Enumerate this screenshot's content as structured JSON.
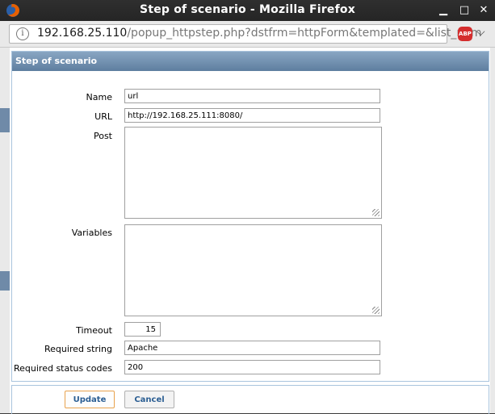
{
  "window": {
    "title": "Step of scenario - Mozilla Firefox",
    "controls": {
      "minimize": "▁",
      "maximize": "□",
      "close": "✕"
    }
  },
  "navbar": {
    "url_host": "192.168.25.110",
    "url_path": "/popup_httpstep.php?dstfrm=httpForm&templated=&list_nam",
    "adblock_label": "ABP",
    "menu_icon": "chevron-down-icon"
  },
  "panel": {
    "title": "Step of scenario"
  },
  "form": {
    "name": {
      "label": "Name",
      "value": "url"
    },
    "url": {
      "label": "URL",
      "value": "http://192.168.25.111:8080/"
    },
    "post": {
      "label": "Post",
      "value": ""
    },
    "variables": {
      "label": "Variables",
      "value": ""
    },
    "timeout": {
      "label": "Timeout",
      "value": "15"
    },
    "required_string": {
      "label": "Required string",
      "value": "Apache"
    },
    "required_status_codes": {
      "label": "Required status codes",
      "value": "200"
    }
  },
  "buttons": {
    "update": "Update",
    "cancel": "Cancel"
  },
  "colors": {
    "header_gradient_top": "#89a6c3",
    "header_gradient_bottom": "#5e7e9f",
    "button_text": "#2b5e93",
    "update_border": "#e8a24d"
  }
}
